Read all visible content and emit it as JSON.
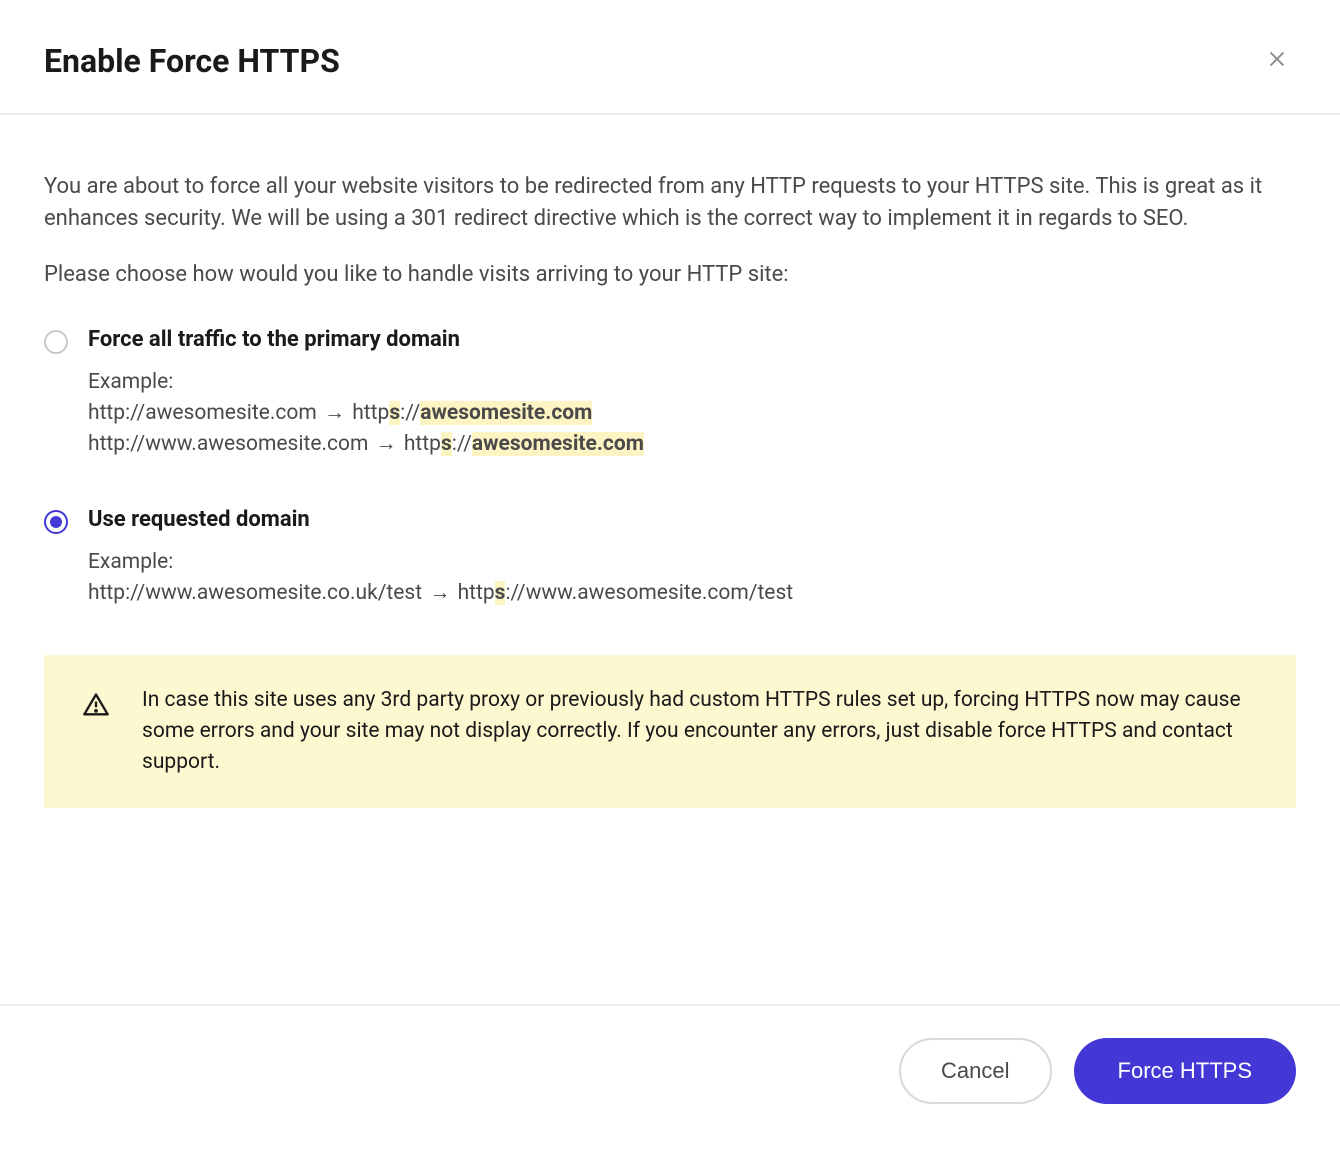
{
  "header": {
    "title": "Enable Force HTTPS"
  },
  "body": {
    "description": "You are about to force all your website visitors to be redirected from any HTTP requests to your HTTPS site. This is great as it enhances security. We will be using a 301 redirect directive which is the correct way to implement it in regards to SEO.",
    "prompt": "Please choose how would you like to handle visits arriving to your HTTP site:",
    "options": [
      {
        "title": "Force all traffic to the primary domain",
        "selected": false,
        "example_label": "Example:",
        "examples": [
          {
            "from": "http://awesomesite.com",
            "arrow": "→",
            "to_prefix": "http",
            "to_s": "s",
            "to_mid": "://",
            "to_highlight": "awesomesite.com"
          },
          {
            "from": "http://www.awesomesite.com",
            "arrow": "→",
            "to_prefix": "http",
            "to_s": "s",
            "to_mid": "://",
            "to_highlight": "awesomesite.com"
          }
        ]
      },
      {
        "title": "Use requested domain",
        "selected": true,
        "example_label": "Example:",
        "examples": [
          {
            "from": "http://www.awesomesite.co.uk/test",
            "arrow": "→",
            "to_prefix": "http",
            "to_s": "s",
            "to_rest": "://www.awesomesite.com/test"
          }
        ]
      }
    ],
    "warning": "In case this site uses any 3rd party proxy or previously had custom HTTPS rules set up, forcing HTTPS now may cause some errors and your site may not display correctly. If you encounter any errors, just disable force HTTPS and contact support."
  },
  "footer": {
    "cancel_label": "Cancel",
    "primary_label": "Force HTTPS"
  }
}
